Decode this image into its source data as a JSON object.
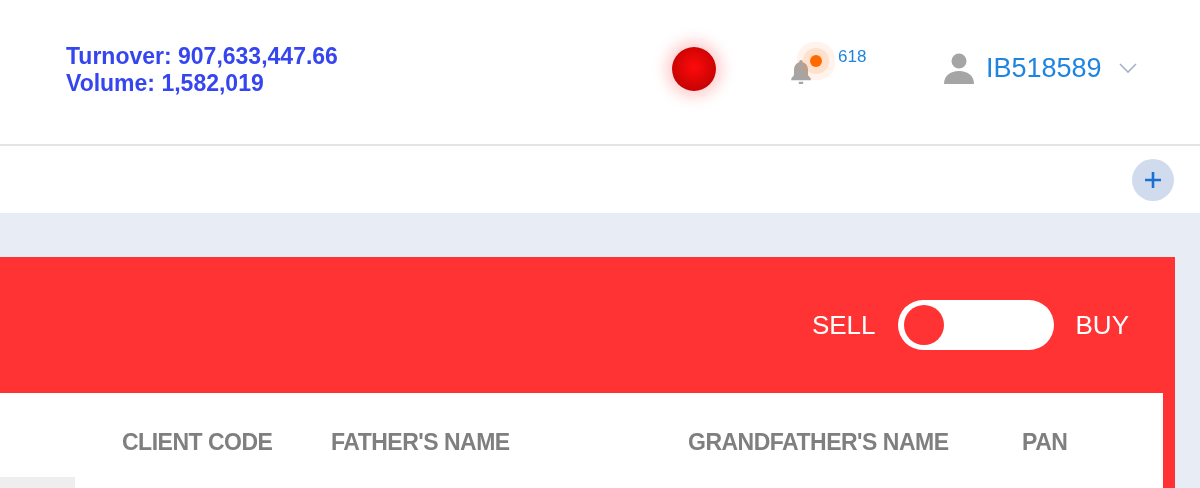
{
  "stats": {
    "turnover": "Turnover: 907,633,447.66",
    "volume": "Volume: 1,582,019"
  },
  "notifications": {
    "count": "618"
  },
  "user": {
    "id": "IB518589"
  },
  "order_side": {
    "sell_label": "SELL",
    "buy_label": "BUY",
    "buy_selected": false
  },
  "table": {
    "columns": [
      "CLIENT CODE",
      "FATHER'S NAME",
      "GRANDFATHER'S NAME",
      "PAN"
    ]
  }
}
